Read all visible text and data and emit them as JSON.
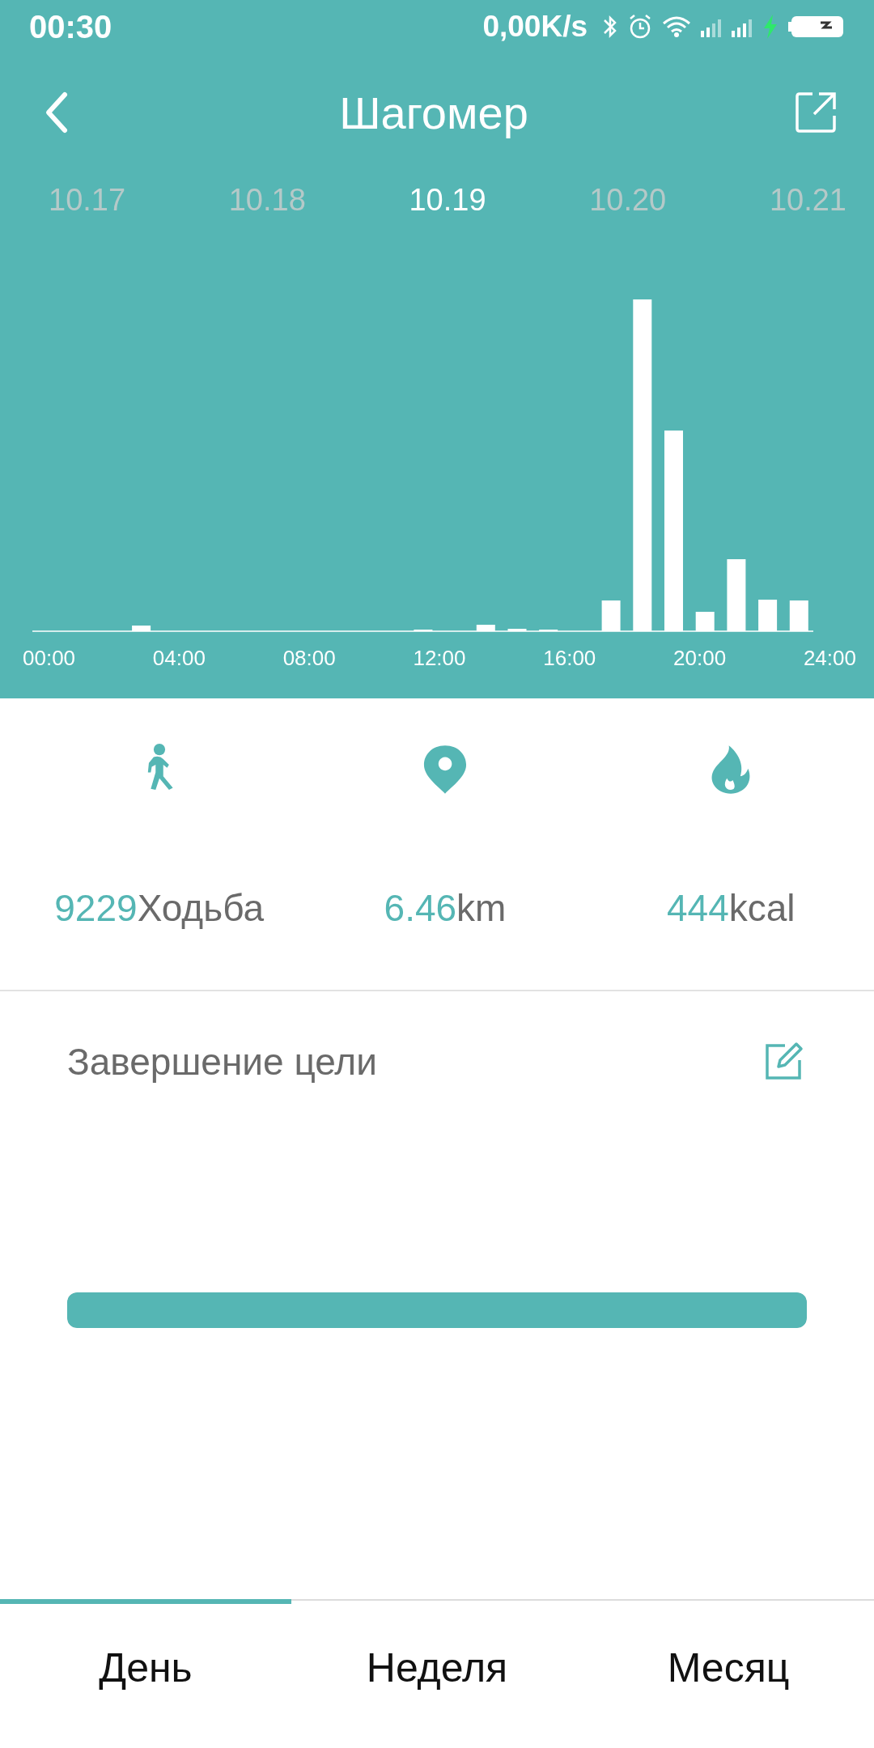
{
  "status_bar": {
    "time": "00:30",
    "speed": "0,00K/s"
  },
  "header": {
    "title": "Шагомер"
  },
  "dates": [
    {
      "label": "10.17",
      "selected": false
    },
    {
      "label": "10.18",
      "selected": false
    },
    {
      "label": "10.19",
      "selected": true
    },
    {
      "label": "10.20",
      "selected": false
    },
    {
      "label": "10.21",
      "selected": false
    }
  ],
  "hour_labels": [
    "00:00",
    "04:00",
    "08:00",
    "12:00",
    "16:00",
    "20:00",
    "24:00"
  ],
  "stats": [
    {
      "kind": "steps",
      "value": "9229",
      "unit": "Ходьба"
    },
    {
      "kind": "distance",
      "value": "6.46",
      "unit": "km"
    },
    {
      "kind": "calories",
      "value": "444",
      "unit": "kcal"
    }
  ],
  "goal": {
    "title": "Завершение цели",
    "level": 1
  },
  "tabs": [
    {
      "label": "День",
      "selected": true
    },
    {
      "label": "Неделя",
      "selected": false
    },
    {
      "label": "Месяц",
      "selected": false
    }
  ]
}
